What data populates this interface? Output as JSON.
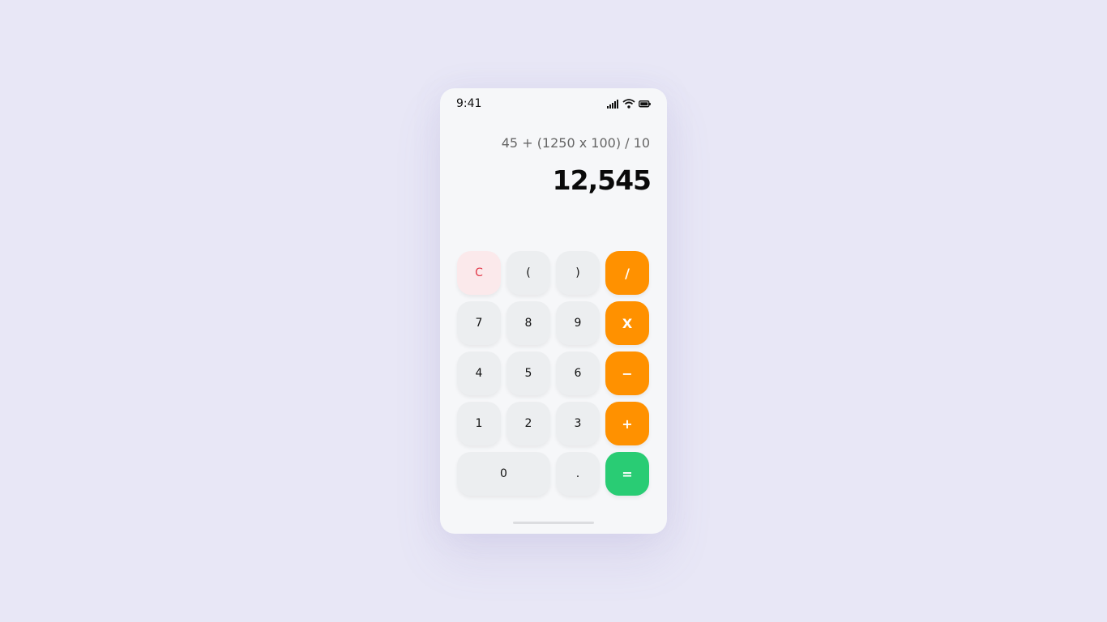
{
  "status_bar": {
    "time": "9:41",
    "icons": [
      "signal-icon",
      "wifi-icon",
      "battery-icon"
    ]
  },
  "display": {
    "expression": "45 + (1250 x 100) / 10",
    "result": "12,545"
  },
  "keys": {
    "clear": "C",
    "open_paren": "(",
    "close_paren": ")",
    "divide": "/",
    "seven": "7",
    "eight": "8",
    "nine": "9",
    "multiply": "X",
    "four": "4",
    "five": "5",
    "six": "6",
    "subtract": "−",
    "one": "1",
    "two": "2",
    "three": "3",
    "add": "+",
    "zero": "0",
    "decimal": ".",
    "equals": "="
  },
  "colors": {
    "operator": "#ff9100",
    "equals": "#29cc74",
    "clear_text": "#e23a4a",
    "clear_bg": "#fbe9eb",
    "background": "#e8e7f6"
  }
}
